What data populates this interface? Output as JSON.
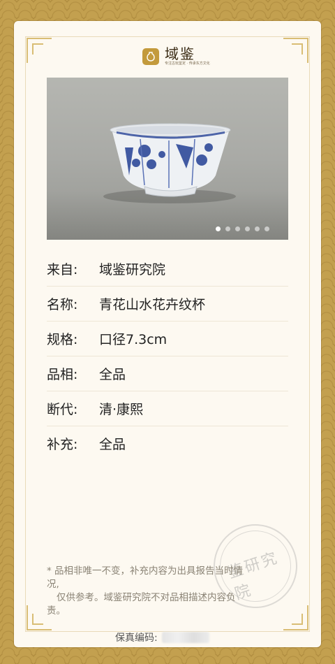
{
  "brand": {
    "name": "域鉴",
    "tagline": "专注古玩鉴定 · 传承东方文化"
  },
  "gallery": {
    "dot_count": 6,
    "active_index": 0
  },
  "details": {
    "from": {
      "label": "来自:",
      "value": "域鉴研究院"
    },
    "name": {
      "label": "名称:",
      "value": "青花山水花卉纹杯"
    },
    "spec": {
      "label": "规格:",
      "value": "口径7.3cm"
    },
    "quality": {
      "label": "品相:",
      "value": "全品"
    },
    "period": {
      "label": "断代:",
      "value": "清·康熙"
    },
    "supplement": {
      "label": "补充:",
      "value": "全品"
    }
  },
  "note": {
    "line1": "* 品相非唯一不变，补充内容为出具报告当时情",
    "line2": "况,",
    "line3": "仅供参考。域鉴研究院不对品相描述内容负",
    "line4": "责。"
  },
  "stamp": {
    "text": "鉴研究院"
  },
  "verification": {
    "label": "保真编码:"
  },
  "colors": {
    "frame": "#c3a04f",
    "card": "#fdf9f1",
    "accent": "#c39a3c"
  }
}
